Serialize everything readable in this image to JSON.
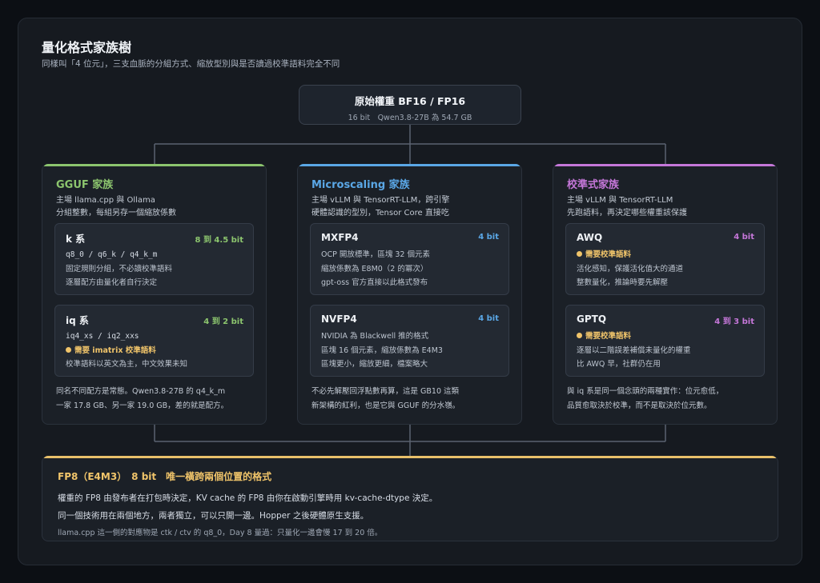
{
  "title": "量化格式家族樹",
  "subtitle": "同樣叫「4 位元」，三支血脈的分組方式、縮放型別與是否讀過校準語料完全不同",
  "root": {
    "title": "原始權重 BF16 / FP16",
    "sub": "16 bit　Qwen3.8-27B 為 54.7 GB"
  },
  "colors": {
    "gguf": "#8cc56e",
    "mx": "#5aa7e6",
    "cal": "#c577d9",
    "fp8": "#e8c06a"
  },
  "families": [
    {
      "title": "GGUF 家族",
      "desc": [
        "主場 llama.cpp 與 Ollama",
        "分組整數，每組另存一個縮放係數"
      ],
      "subs": [
        {
          "name": "k 系",
          "bits": "8 到 4.5 bit",
          "code": "q8_0 / q6_k / q4_k_m",
          "warn": "",
          "lines": [
            "固定規則分組，不必讀校準語料",
            "逐層配方由量化者自行決定"
          ]
        },
        {
          "name": "iq 系",
          "bits": "4 到 2 bit",
          "code": "iq4_xs / iq2_xxs",
          "warn": "需要 imatrix 校準語料",
          "lines": [
            "校準語料以英文為主，中文效果未知"
          ]
        }
      ],
      "note": [
        "同名不同配方是常態。Qwen3.8-27B 的 q4_k_m",
        "一家 17.8 GB、另一家 19.0 GB，差的就是配方。"
      ]
    },
    {
      "title": "Microscaling 家族",
      "desc": [
        "主場 vLLM 與 TensorRT-LLM，跨引擎",
        "硬體認識的型別，Tensor Core 直接吃"
      ],
      "subs": [
        {
          "name": "MXFP4",
          "bits": "4 bit",
          "code": "",
          "warn": "",
          "lines": [
            "OCP 開放標準，區塊 32 個元素",
            "縮放係數為 E8M0（2 的冪次）",
            "gpt-oss 官方直接以此格式發布"
          ]
        },
        {
          "name": "NVFP4",
          "bits": "4 bit",
          "code": "",
          "warn": "",
          "lines": [
            "NVIDIA 為 Blackwell 推的格式",
            "區塊 16 個元素，縮放係數為 E4M3",
            "區塊更小，縮放更細，檔案略大"
          ]
        }
      ],
      "note": [
        "不必先解壓回浮點數再算，這是 GB10 這類",
        "新架構的紅利，也是它與 GGUF 的分水嶺。"
      ]
    },
    {
      "title": "校準式家族",
      "desc": [
        "主場 vLLM 與 TensorRT-LLM",
        "先跑語料，再決定哪些權重該保護"
      ],
      "subs": [
        {
          "name": "AWQ",
          "bits": "4 bit",
          "code": "",
          "warn": "需要校準語料",
          "lines": [
            "活化感知，保護活化值大的通道",
            "整數量化，推論時要先解壓"
          ]
        },
        {
          "name": "GPTQ",
          "bits": "4 到 3 bit",
          "code": "",
          "warn": "需要校準語料",
          "lines": [
            "逐層以二階誤差補償未量化的權重",
            "比 AWQ 早，社群仍在用"
          ]
        }
      ],
      "note": [
        "與 iq 系是同一個念頭的兩種實作：位元愈低，",
        "品質愈取決於校準，而不是取決於位元數。"
      ]
    }
  ],
  "fp8": {
    "title": "FP8（E4M3）　8 bit　唯一橫跨兩個位置的格式",
    "line1": "權重的 FP8 由發布者在打包時決定，KV cache 的 FP8 由你在啟動引擎時用 kv-cache-dtype 決定。",
    "line2": "同一個技術用在兩個地方，兩者獨立，可以只開一邊。Hopper 之後硬體原生支援。",
    "line3": "llama.cpp 這一側的對應物是 ctk / ctv 的 q8_0，Day 8 量過：只量化一邊會慢 17 到 20 倍。"
  }
}
